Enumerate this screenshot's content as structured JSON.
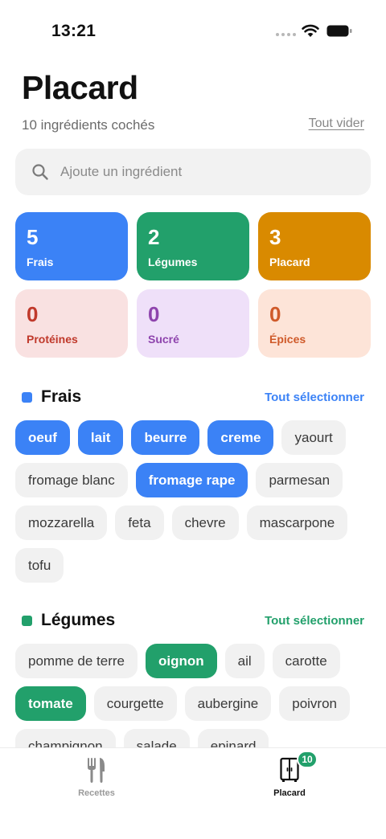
{
  "status_bar": {
    "time": "13:21"
  },
  "header": {
    "title": "Placard",
    "subtitle": "10 ingrédients cochés",
    "clear_label": "Tout vider"
  },
  "search": {
    "placeholder": "Ajoute un ingrédient",
    "value": ""
  },
  "categories": [
    {
      "count": "5",
      "label": "Frais",
      "bg": "#3b82f6",
      "fg": "#ffffff"
    },
    {
      "count": "2",
      "label": "Légumes",
      "bg": "#22a06b",
      "fg": "#ffffff"
    },
    {
      "count": "3",
      "label": "Placard",
      "bg": "#d98a00",
      "fg": "#ffffff"
    },
    {
      "count": "0",
      "label": "Protéines",
      "bg": "#f9e1e1",
      "fg": "#c0392b"
    },
    {
      "count": "0",
      "label": "Sucré",
      "bg": "#efe0f9",
      "fg": "#8e44ad"
    },
    {
      "count": "0",
      "label": "Épices",
      "bg": "#fde4d8",
      "fg": "#cf5a2a"
    }
  ],
  "sections": [
    {
      "title": "Frais",
      "select_all_label": "Tout sélectionner",
      "color": "#3b82f6",
      "items": [
        {
          "label": "oeuf",
          "selected": true
        },
        {
          "label": "lait",
          "selected": true
        },
        {
          "label": "beurre",
          "selected": true
        },
        {
          "label": "creme",
          "selected": true
        },
        {
          "label": "yaourt",
          "selected": false
        },
        {
          "label": "fromage blanc",
          "selected": false
        },
        {
          "label": "fromage rape",
          "selected": true
        },
        {
          "label": "parmesan",
          "selected": false
        },
        {
          "label": "mozzarella",
          "selected": false
        },
        {
          "label": "feta",
          "selected": false
        },
        {
          "label": "chevre",
          "selected": false
        },
        {
          "label": "mascarpone",
          "selected": false
        },
        {
          "label": "tofu",
          "selected": false
        }
      ]
    },
    {
      "title": "Légumes",
      "select_all_label": "Tout sélectionner",
      "color": "#22a06b",
      "items": [
        {
          "label": "pomme de terre",
          "selected": false
        },
        {
          "label": "oignon",
          "selected": true
        },
        {
          "label": "ail",
          "selected": false
        },
        {
          "label": "carotte",
          "selected": false
        },
        {
          "label": "tomate",
          "selected": true
        },
        {
          "label": "courgette",
          "selected": false
        },
        {
          "label": "aubergine",
          "selected": false
        },
        {
          "label": "poivron",
          "selected": false
        },
        {
          "label": "champignon",
          "selected": false
        },
        {
          "label": "salade",
          "selected": false
        },
        {
          "label": "epinard",
          "selected": false
        }
      ]
    }
  ],
  "tab_bar": {
    "tabs": [
      {
        "label": "Recettes",
        "icon": "fork-knife-icon",
        "active": false
      },
      {
        "label": "Placard",
        "icon": "cupboard-icon",
        "active": true,
        "badge": "10"
      }
    ]
  }
}
